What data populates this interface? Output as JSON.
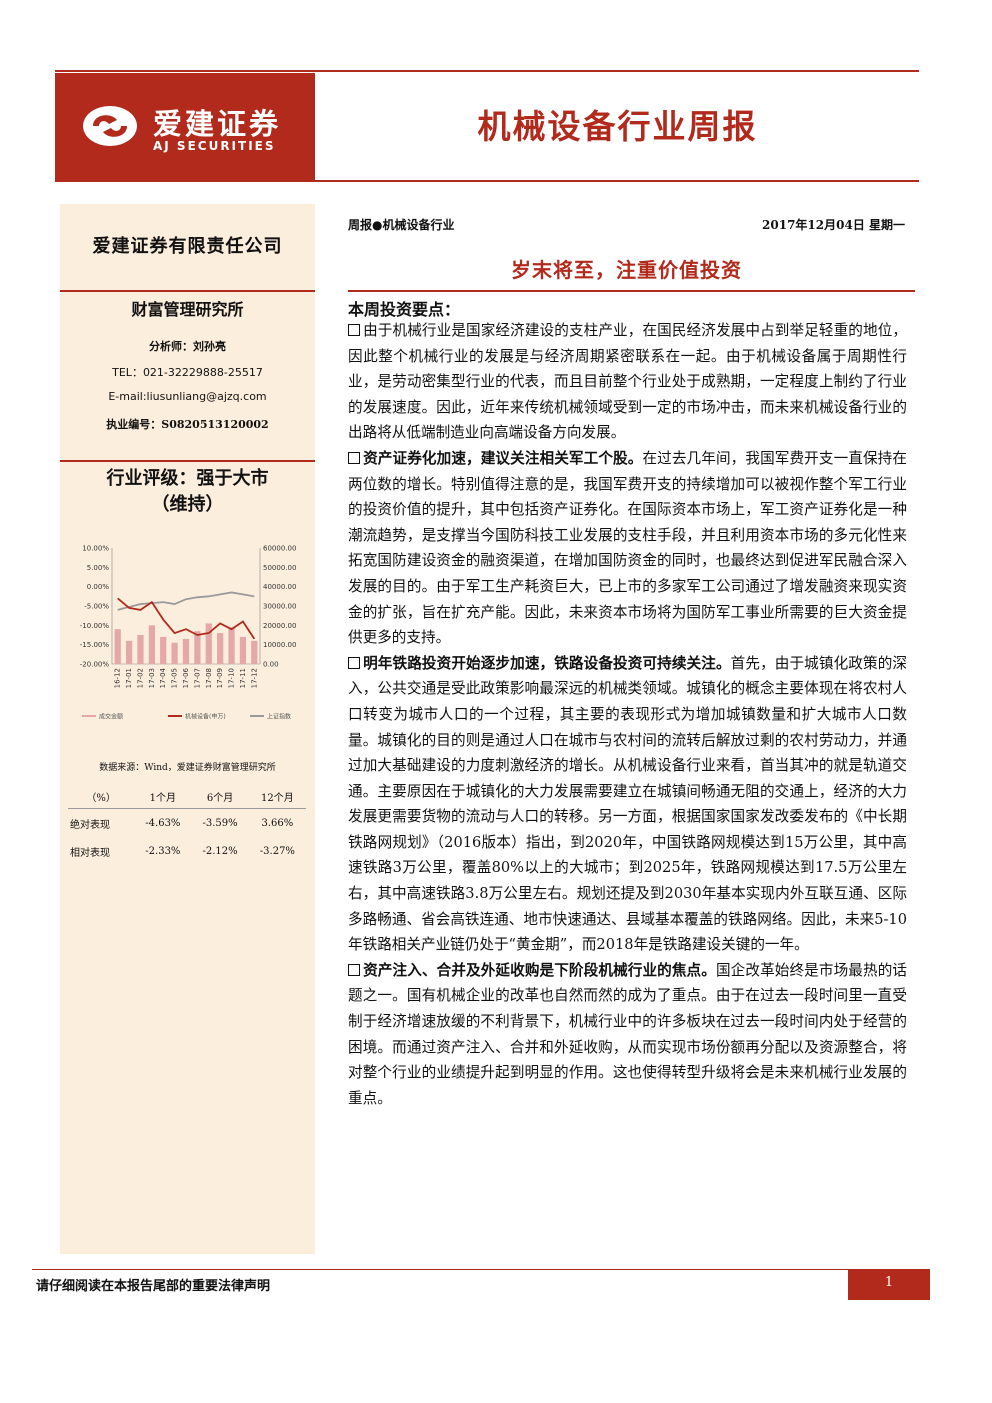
{
  "header": {
    "logo_cn": "爱建证券",
    "logo_en": "AJ SECURITIES",
    "report_title": "机械设备行业周报"
  },
  "sidebar": {
    "company": "爱建证券有限责任公司",
    "department": "财富管理研究所",
    "analyst": "分析师：刘孙亮",
    "tel": "TEL：021-32229888-25517",
    "email": "E-mail:liusunliang@ajzq.com",
    "license": "执业编号：S0820513120002",
    "rating_line1": "行业评级：强于大市",
    "rating_line2": "（维持）",
    "source_note": "数据来源：Wind，爱建证券财富管理研究所",
    "perf_table": {
      "headers": [
        "（%）",
        "1个月",
        "6个月",
        "12个月"
      ],
      "rows": [
        [
          "绝对表现",
          "-4.63%",
          "-3.59%",
          "3.66%"
        ],
        [
          "相对表现",
          "-2.33%",
          "-2.12%",
          "-3.27%"
        ]
      ]
    }
  },
  "main": {
    "meta_left": "周报●机械设备行业",
    "meta_right": "2017年12月04日 星期一",
    "subtitle": "岁末将至，注重价值投资",
    "section_heading": "本周投资要点：",
    "p1": "由于机械行业是国家经济建设的支柱产业，在国民经济发展中占到举足轻重的地位，因此整个机械行业的发展是与经济周期紧密联系在一起。由于机械设备属于周期性行业，是劳动密集型行业的代表，而且目前整个行业处于成熟期，一定程度上制约了行业的发展速度。因此，近年来传统机械领域受到一定的市场冲击，而未来机械设备行业的出路将从低端制造业向高端设备方向发展。",
    "p2_lead": "资产证券化加速，建议关注相关军工个股。",
    "p2": "在过去几年间，我国军费开支一直保持在两位数的增长。特别值得注意的是，我国军费开支的持续增加可以被视作整个军工行业的投资价值的提升，其中包括资产证券化。在国际资本市场上，军工资产证券化是一种潮流趋势，是支撑当今国防科技工业发展的支柱手段，并且利用资本市场的多元化性来拓宽国防建设资金的融资渠道，在增加国防资金的同时，也最终达到促进军民融合深入发展的目的。由于军工生产耗资巨大，已上市的多家军工公司通过了增发融资来现实资金的扩张，旨在扩充产能。因此，未来资本市场将为国防军工事业所需要的巨大资金提供更多的支持。",
    "p3_lead": "明年铁路投资开始逐步加速，铁路设备投资可持续关注。",
    "p3": "首先，由于城镇化政策的深入，公共交通是受此政策影响最深远的机械类领域。城镇化的概念主要体现在将农村人口转变为城市人口的一个过程，其主要的表现形式为增加城镇数量和扩大城市人口数量。城镇化的目的则是通过人口在城市与农村间的流转后解放过剩的农村劳动力，并通过加大基础建设的力度刺激经济的增长。从机械设备行业来看，首当其冲的就是轨道交通。主要原因在于城镇化的大力发展需要建立在城镇间畅通无阻的交通上，经济的大力发展更需要货物的流动与人口的转移。另一方面，根据国家国家发改委发布的《中长期铁路网规划》（2016版本）指出，到2020年，中国铁路网规模达到15万公里，其中高速铁路3万公里，覆盖80%以上的大城市；到2025年，铁路网规模达到17.5万公里左右，其中高速铁路3.8万公里左右。规划还提及到2030年基本实现内外互联互通、区际多路畅通、省会高铁连通、地市快速通达、县域基本覆盖的铁路网络。因此，未来5-10年铁路相关产业链仍处于“黄金期”，而2018年是铁路建设关键的一年。",
    "p4_lead": "资产注入、合并及外延收购是下阶段机械行业的焦点。",
    "p4": "国企改革始终是市场最热的话题之一。国有机械企业的改革也自然而然的成为了重点。由于在过去一段时间里一直受制于经济增速放缓的不利背景下，机械行业中的许多板块在过去一段时间内处于经营的困境。而通过资产注入、合并和外延收购，从而实现市场份额再分配以及资源整合，将对整个行业的业绩提升起到明显的作用。这也使得转型升级将会是未来机械行业发展的重点。"
  },
  "footer": {
    "note": "请仔细阅读在本报告尾部的重要法律声明",
    "page": "1"
  },
  "chart_data": {
    "type": "bar",
    "categories": [
      "16-12",
      "17-01",
      "17-02",
      "17-03",
      "17-04",
      "17-05",
      "17-06",
      "17-07",
      "17-08",
      "17-09",
      "17-10",
      "17-11",
      "17-12"
    ],
    "series": [
      {
        "name": "成交金额",
        "type": "bar",
        "axis": "right",
        "values": [
          18000,
          12000,
          15000,
          20000,
          14000,
          11000,
          13000,
          17000,
          21000,
          16000,
          19000,
          14000,
          12000
        ]
      },
      {
        "name": "机械设备(申万)",
        "type": "line",
        "axis": "left",
        "values": [
          -3.0,
          -5.5,
          -6.0,
          -4.0,
          -8.5,
          -12.0,
          -11.0,
          -12.5,
          -12.0,
          -9.5,
          -11.0,
          -9.0,
          -13.5
        ]
      },
      {
        "name": "上证指数",
        "type": "line",
        "axis": "right",
        "values": [
          28000,
          29500,
          31000,
          31500,
          32000,
          31000,
          33500,
          34500,
          35000,
          36000,
          37000,
          36000,
          35000
        ]
      }
    ],
    "y_left_ticks": [
      "10.00%",
      "5.00%",
      "0.00%",
      "-5.00%",
      "-10.00%",
      "-15.00%",
      "-20.00%"
    ],
    "y_left_range": [
      -20,
      10
    ],
    "y_right_ticks": [
      "60000.00",
      "50000.00",
      "40000.00",
      "30000.00",
      "20000.00",
      "10000.00",
      "0.00"
    ],
    "y_right_range": [
      0,
      60000
    ],
    "colors": {
      "bars": "#e4a8a8",
      "industry_line": "#b22a1c",
      "index_line": "#9a9a9a"
    }
  }
}
